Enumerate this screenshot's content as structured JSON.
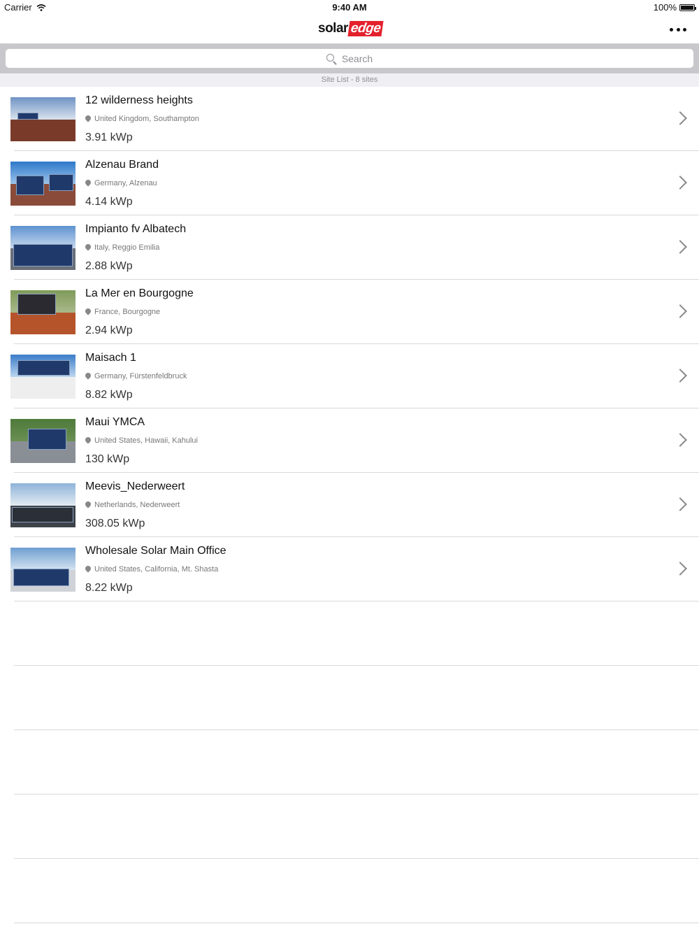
{
  "status_bar": {
    "carrier": "Carrier",
    "time": "9:40 AM",
    "battery": "100%"
  },
  "nav": {
    "logo_left": "solar",
    "logo_right": "edge",
    "more_icon": "more-horizontal-icon"
  },
  "search": {
    "placeholder": "Search"
  },
  "list_header": "Site List - 8 sites",
  "sites": [
    {
      "name": "12 wilderness heights",
      "location": "United Kingdom, Southampton",
      "power": "3.91 kWp"
    },
    {
      "name": "Alzenau Brand",
      "location": "Germany, Alzenau",
      "power": "4.14 kWp"
    },
    {
      "name": "Impianto fv Albatech",
      "location": "Italy, Reggio Emilia",
      "power": "2.88 kWp"
    },
    {
      "name": "La Mer en Bourgogne",
      "location": "France, Bourgogne",
      "power": "2.94 kWp"
    },
    {
      "name": "Maisach 1",
      "location": "Germany, Fürstenfeldbruck",
      "power": "8.82 kWp"
    },
    {
      "name": "Maui YMCA",
      "location": "United States, Hawaii, Kahului",
      "power": "130 kWp"
    },
    {
      "name": "Meevis_Nederweert",
      "location": "Netherlands, Nederweert",
      "power": "308.05 kWp"
    },
    {
      "name": "Wholesale Solar Main Office",
      "location": "United States, California, Mt. Shasta",
      "power": "8.22 kWp"
    }
  ],
  "colors": {
    "brand_red": "#e3212d",
    "search_bg": "#c8c8cc",
    "header_bg": "#efeff4"
  }
}
